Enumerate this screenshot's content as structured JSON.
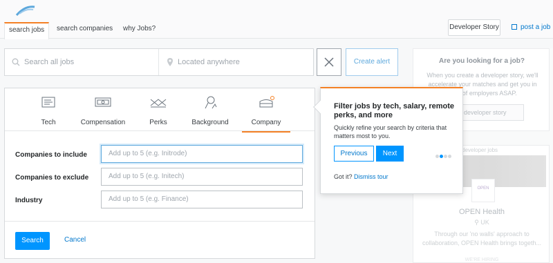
{
  "header": {
    "tabs": [
      {
        "label": "search jobs",
        "active": true
      },
      {
        "label": "search companies",
        "active": false
      },
      {
        "label": "why Jobs?",
        "active": false
      }
    ],
    "developer_story": "Developer Story",
    "post_job": "post a job"
  },
  "search": {
    "jobs_placeholder": "Search all jobs",
    "location_placeholder": "Located anywhere",
    "create_alert": "Create alert"
  },
  "filters": {
    "categories": [
      {
        "label": "Tech",
        "icon": "tech-icon"
      },
      {
        "label": "Compensation",
        "icon": "compensation-icon"
      },
      {
        "label": "Perks",
        "icon": "perks-icon"
      },
      {
        "label": "Background",
        "icon": "background-icon"
      },
      {
        "label": "Company",
        "icon": "company-icon",
        "active": true
      }
    ],
    "fields": [
      {
        "label": "Companies to include",
        "placeholder": "Add up to 5 (e.g. Initrode)"
      },
      {
        "label": "Companies to exclude",
        "placeholder": "Add up to 5 (e.g. Initech)"
      },
      {
        "label": "Industry",
        "placeholder": "Add up to 5 (e.g. Finance)"
      }
    ],
    "search_button": "Search",
    "cancel_button": "Cancel"
  },
  "tour": {
    "title": "Filter jobs by tech, salary, remote perks, and more",
    "body": "Quickly refine your search by criteria that matters most to you.",
    "previous": "Previous",
    "next": "Next",
    "got_it": "Got it?",
    "dismiss": "Dismiss tour",
    "step": 2,
    "total_steps": 4
  },
  "sidebar": {
    "title": "Are you looking for a job?",
    "text": "When you create a developer story, we'll accelerate your matches and get you in front of employers ASAP.",
    "button": "a developer story",
    "ad": {
      "tag": "developer jobs",
      "logo_text": "OPEN",
      "company": "OPEN Health",
      "location": "UK",
      "description": "Through our 'no walls' approach to collaboration, OPEN Health brings togeth...",
      "hiring": "WE'RE HIRING"
    }
  },
  "colors": {
    "accent": "#f48024",
    "primary": "#0095ff",
    "link": "#0077cc"
  }
}
